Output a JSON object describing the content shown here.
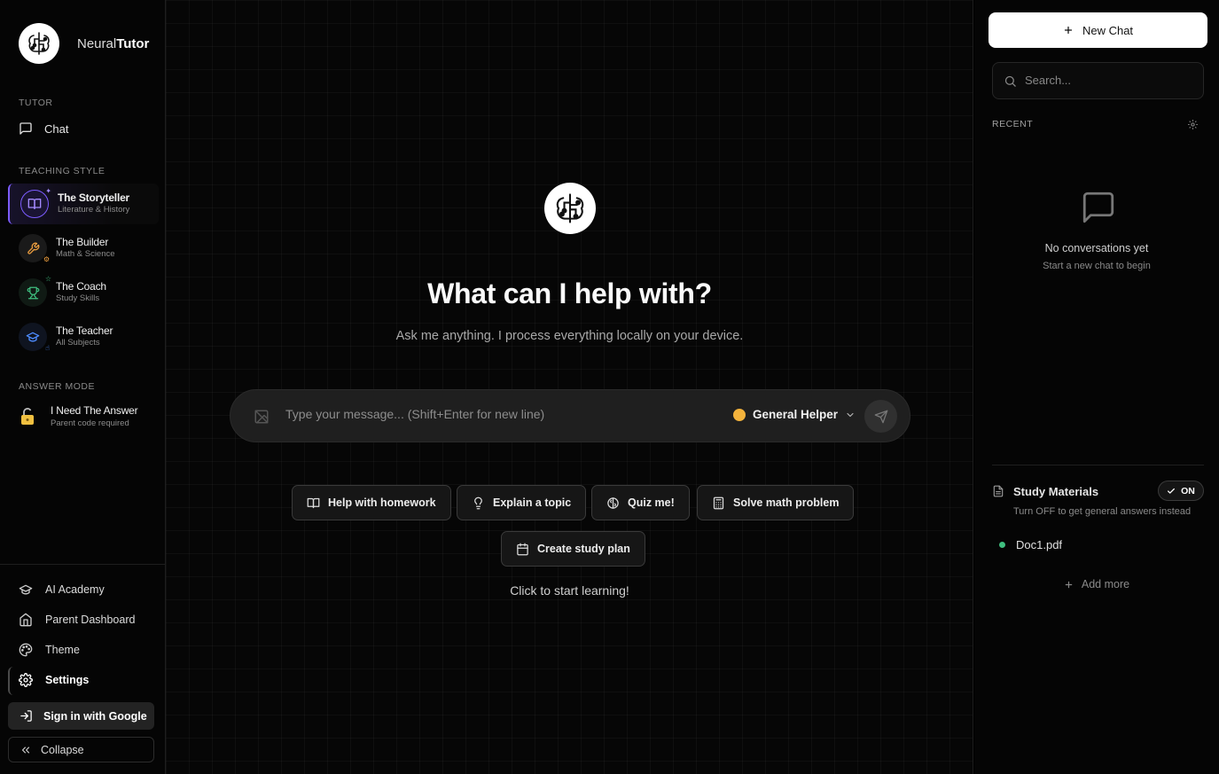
{
  "brand": {
    "name_light": "Neural",
    "name_bold": "Tutor"
  },
  "sidebar": {
    "tutor_label": "TUTOR",
    "chat_label": "Chat",
    "teaching_style_label": "TEACHING STYLE",
    "styles": [
      {
        "title": "The Storyteller",
        "subtitle": "Literature & History",
        "icon": "book-icon",
        "color": "#8b6cff",
        "active": true
      },
      {
        "title": "The Builder",
        "subtitle": "Math & Science",
        "icon": "wrench-icon",
        "color": "#f0a040",
        "active": false
      },
      {
        "title": "The Coach",
        "subtitle": "Study Skills",
        "icon": "trophy-icon",
        "color": "#3fbf7f",
        "active": false
      },
      {
        "title": "The Teacher",
        "subtitle": "All Subjects",
        "icon": "graduation-cap-icon",
        "color": "#4d8cff",
        "active": false
      }
    ],
    "answer_mode_label": "ANSWER MODE",
    "answer_mode": {
      "title": "I Need The Answer",
      "subtitle": "Parent code required"
    },
    "bottom": {
      "ai_academy": "AI Academy",
      "parent_dashboard": "Parent Dashboard",
      "theme": "Theme",
      "settings": "Settings",
      "sign_in": "Sign in with Google",
      "collapse": "Collapse"
    }
  },
  "main": {
    "title": "What can I help with?",
    "subtitle": "Ask me anything. I process everything locally on your device.",
    "composer": {
      "placeholder": "Type your message... (Shift+Enter for new line)",
      "helper": "General Helper"
    },
    "chips": [
      {
        "label": "Help with homework",
        "icon": "book-icon"
      },
      {
        "label": "Explain a topic",
        "icon": "lightbulb-icon"
      },
      {
        "label": "Quiz me!",
        "icon": "brain-icon"
      },
      {
        "label": "Solve math problem",
        "icon": "calculator-icon"
      },
      {
        "label": "Create study plan",
        "icon": "calendar-icon"
      }
    ],
    "start_text": "Click to start learning!"
  },
  "right_panel": {
    "new_chat": "New Chat",
    "search_placeholder": "Search...",
    "recent_label": "RECENT",
    "empty_title": "No conversations yet",
    "empty_subtitle": "Start a new chat to begin",
    "study_materials": {
      "title": "Study Materials",
      "toggle": "ON",
      "subtitle": "Turn OFF to get general answers instead",
      "documents": [
        "Doc1.pdf"
      ],
      "add_more": "Add more"
    }
  },
  "colors": {
    "accent": "#7c5cff",
    "doc_dot": "#3fbf7f",
    "helper_emoji": "#f3b33c"
  }
}
